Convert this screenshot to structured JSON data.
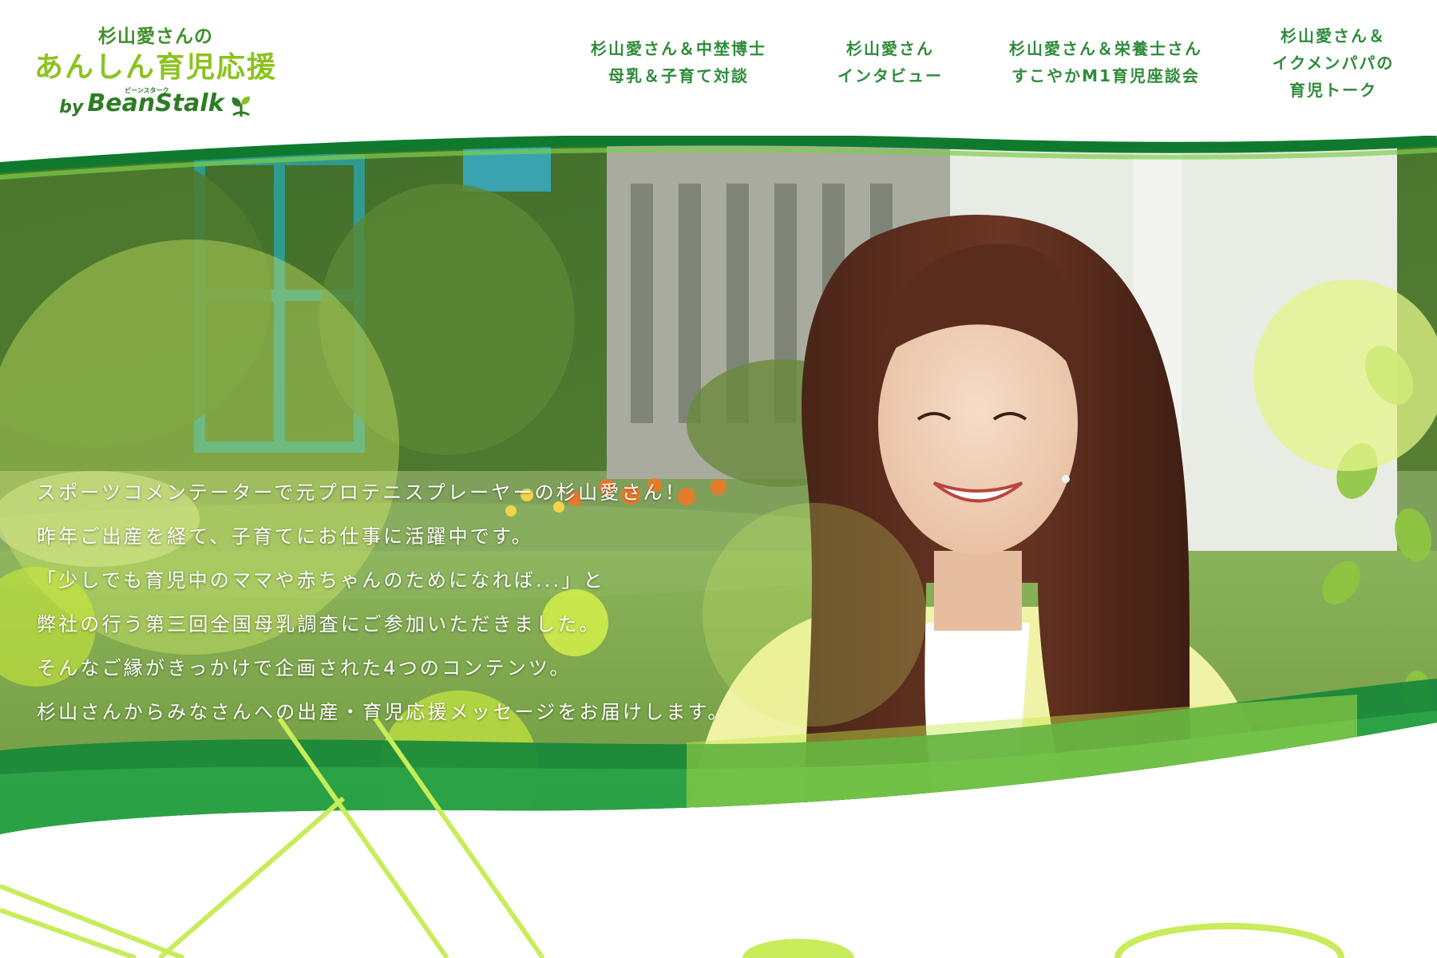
{
  "header": {
    "logo": {
      "line1": "杉山愛さんの",
      "line2": "あんしん育児応援",
      "by": "by",
      "brand": "BeanStalk",
      "brand_ruby": "ビーンスターク"
    },
    "nav": [
      {
        "lines": [
          "杉山愛さん＆中埜博士",
          "母乳＆子育て対談"
        ]
      },
      {
        "lines": [
          "杉山愛さん",
          "インタビュー"
        ]
      },
      {
        "lines": [
          "杉山愛さん＆栄養士さん",
          "すこやかM1育児座談会"
        ]
      },
      {
        "lines": [
          "杉山愛さん＆",
          "イクメンパパの",
          "育児トーク"
        ]
      }
    ]
  },
  "hero": {
    "text_lines": [
      "スポーツコメンテーターで元プロテニスプレーヤーの杉山愛さん！",
      "昨年ご出産を経て、子育てにお仕事に活躍中です。",
      "「少しでも育児中のママや赤ちゃんのためになれば...」と",
      "弊社の行う第三回全国母乳調査にご参加いただきました。",
      "そんなご縁がきっかけで企画された4つのコンテンツ。",
      "杉山さんからみなさんへの出産・育児応援メッセージをお届けします。"
    ]
  },
  "colors": {
    "brand_green": "#2e8b3a",
    "lime": "#8cc21f",
    "dark_green": "#0f7a2e"
  },
  "icons": [
    "sprout-icon"
  ]
}
